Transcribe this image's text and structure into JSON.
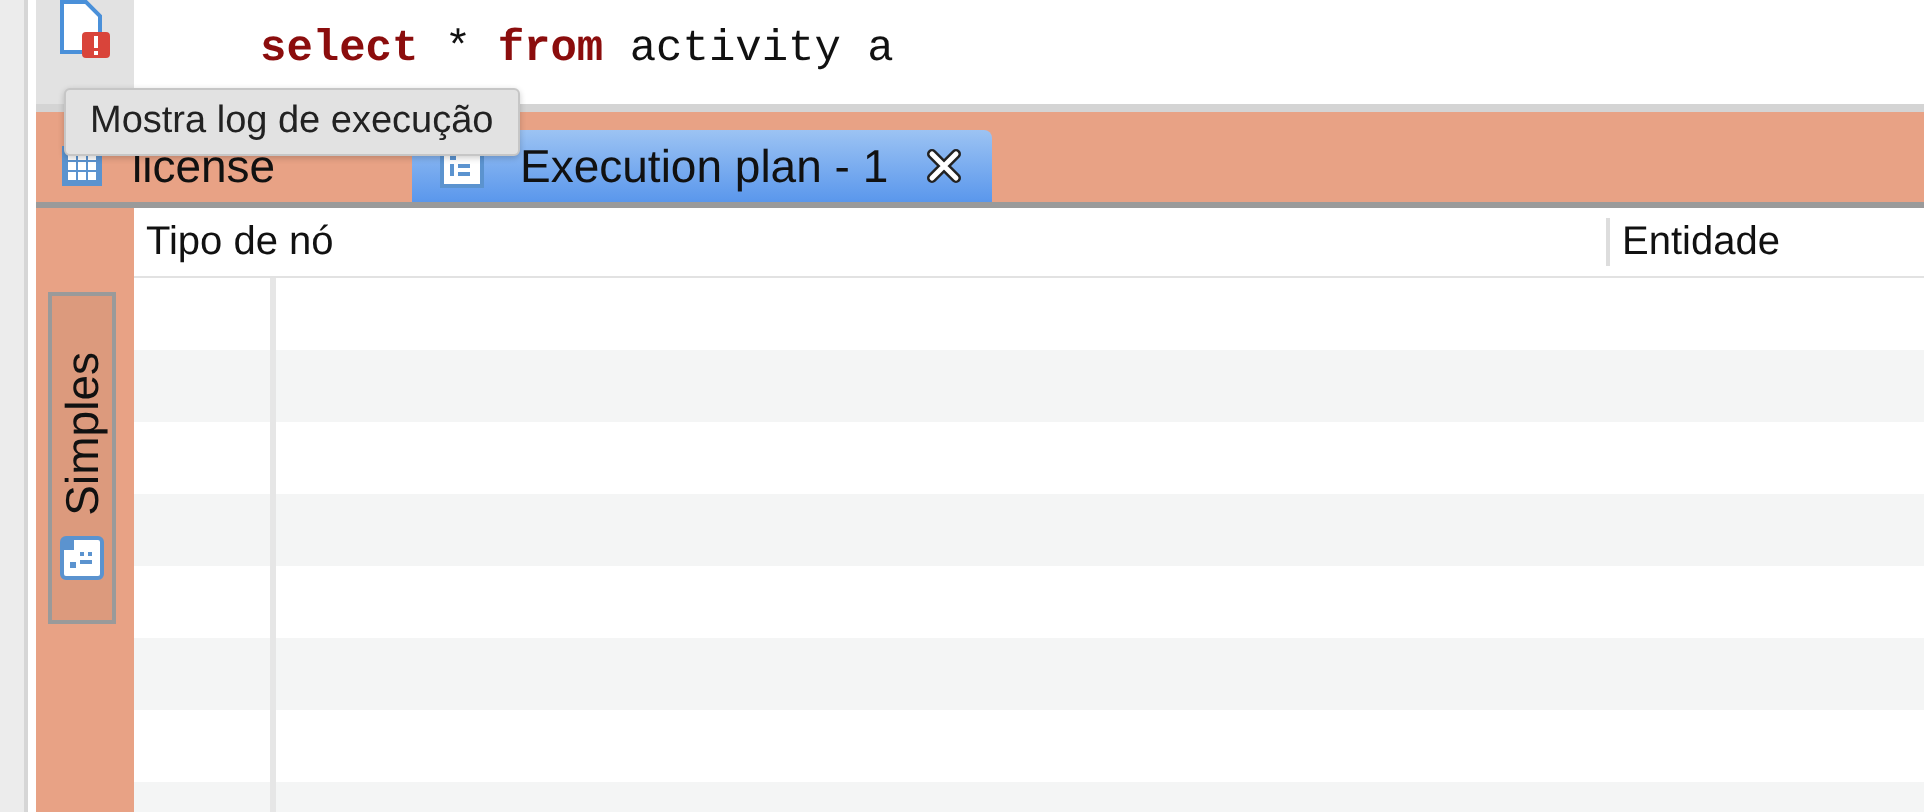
{
  "editor": {
    "code": [
      {
        "text": "select",
        "kind": "keyword"
      },
      {
        "text": " * ",
        "kind": "plain"
      },
      {
        "text": "from",
        "kind": "keyword"
      },
      {
        "text": " activity a",
        "kind": "plain"
      }
    ]
  },
  "tooltip": "Mostra log de execução",
  "tabs": [
    {
      "label": "license",
      "kind": "grid",
      "selected": false,
      "closable": false
    },
    {
      "label": "Execution plan - 1",
      "kind": "plan",
      "selected": true,
      "closable": true
    }
  ],
  "side_tabs": [
    {
      "label": "Simples",
      "selected": true
    }
  ],
  "table": {
    "columns": [
      "Tipo de nó",
      "Entidade"
    ]
  }
}
